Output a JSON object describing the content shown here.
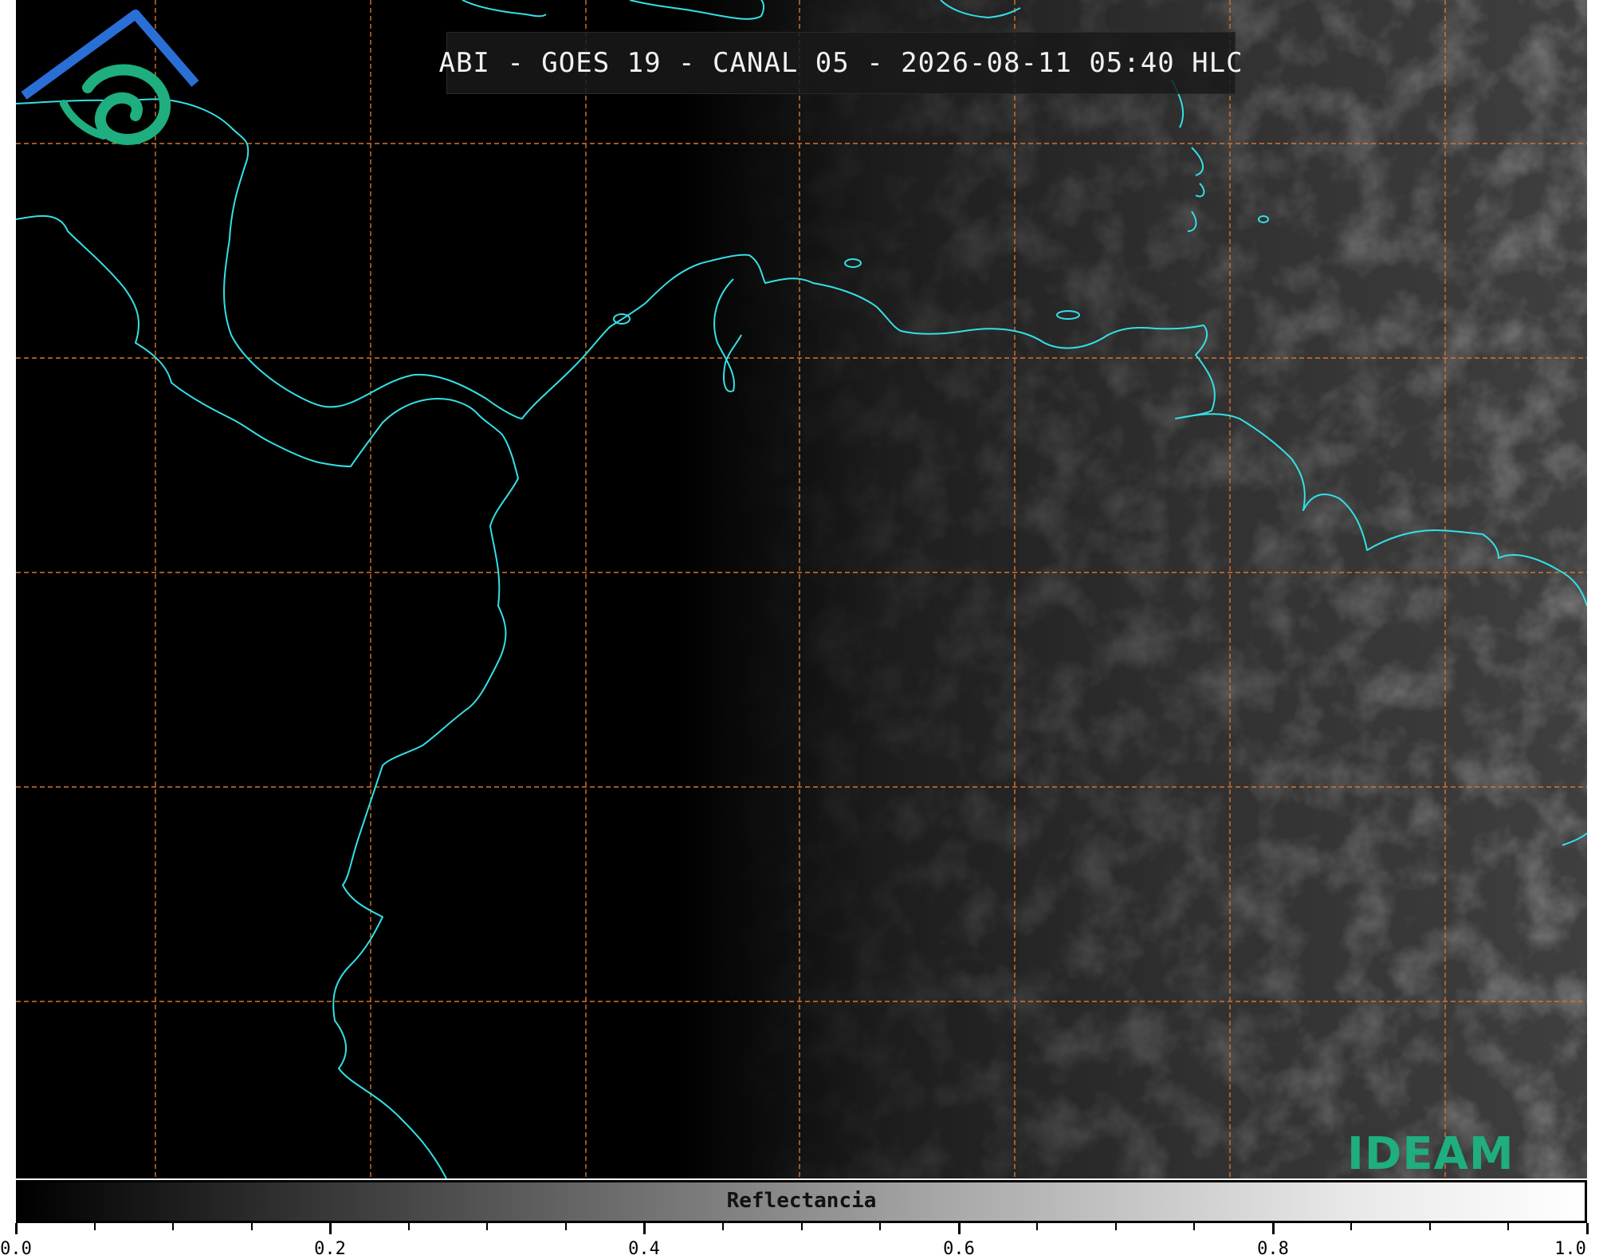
{
  "title": "ABI - GOES 19 - CANAL 05 - 2026-08-11 05:40 HLC",
  "colorbar": {
    "label": "Reflectancia",
    "min": 0.0,
    "max": 1.0,
    "tick_labels": [
      "0.0",
      "0.2",
      "0.4",
      "0.6",
      "0.8",
      "1.0"
    ]
  },
  "logo": {
    "text": "IDEAM"
  },
  "colors": {
    "coastline": "#33e0e6",
    "gridline": "#d9742a",
    "logo_green": "#1fae7f",
    "logo_blue": "#2a6fd6"
  }
}
